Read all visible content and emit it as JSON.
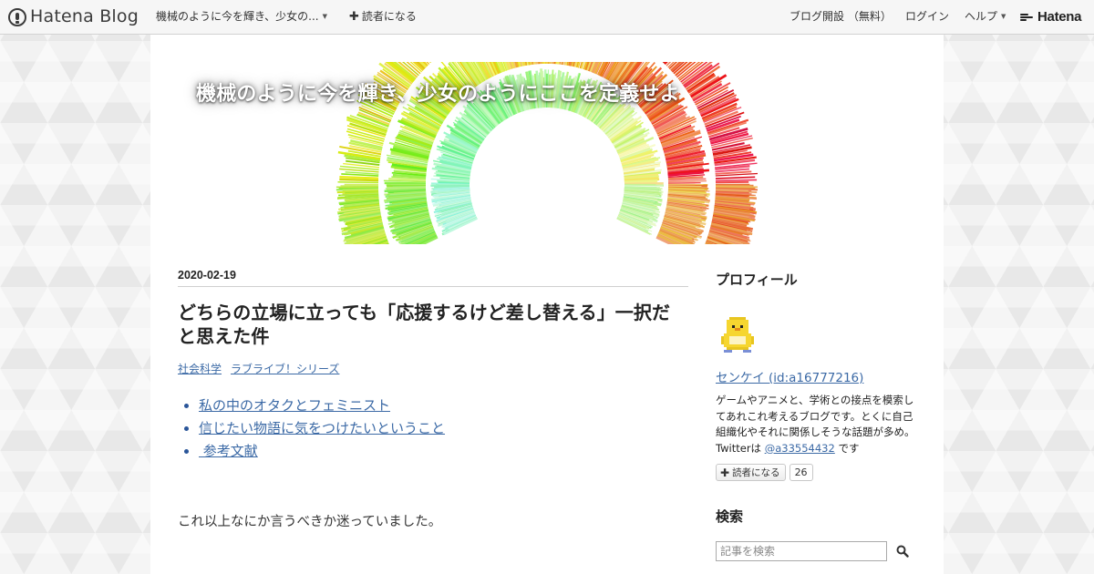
{
  "topbar": {
    "logo_text": "Hatena Blog",
    "blog_menu_label": "機械のように今を輝き、少女の...",
    "subscribe_label": "読者になる",
    "start_blog_label": "ブログ開設 （無料）",
    "login_label": "ログイン",
    "help_label": "ヘルプ",
    "hatena_label": "Hatena"
  },
  "header": {
    "blog_title": "機械のように今を輝き、少女のようにここを定義せよ"
  },
  "entry": {
    "date": "2020-02-19",
    "title": "どちらの立場に立っても「応援するけど差し替える」一択だと思えた件",
    "categories": [
      "社会科学",
      "ラブライブ！シリーズ"
    ],
    "toc": [
      "私の中のオタクとフェミニスト",
      "信じたい物語に気をつけたいということ",
      " 参考文献"
    ],
    "body_first_line": "これ以上なにか言うべきか迷っていました。"
  },
  "sidebar": {
    "profile_title": "プロフィール",
    "profile_name": "センケイ (id:a16777216)",
    "profile_desc_prefix": "ゲームやアニメと、学術との接点を模索してあれこれ考えるブログです。とくに自己組織化やそれに関係しそうな話題が多め。Twitterは ",
    "profile_twitter": "@a33554432",
    "profile_desc_suffix": " です",
    "subscribe_label": "読者になる",
    "subscribe_count": "26",
    "search_title": "検索",
    "search_placeholder": "記事を検索"
  },
  "colors": {
    "link": "#3c6aa6",
    "container_bg": "#ffffff",
    "page_bg": "#ececec"
  },
  "icons": {
    "logo": "hatena-blog-logo-icon",
    "caret": "caret-down-icon",
    "plus": "plus-icon",
    "search": "search-icon",
    "avatar": "pixel-penguin-avatar"
  }
}
